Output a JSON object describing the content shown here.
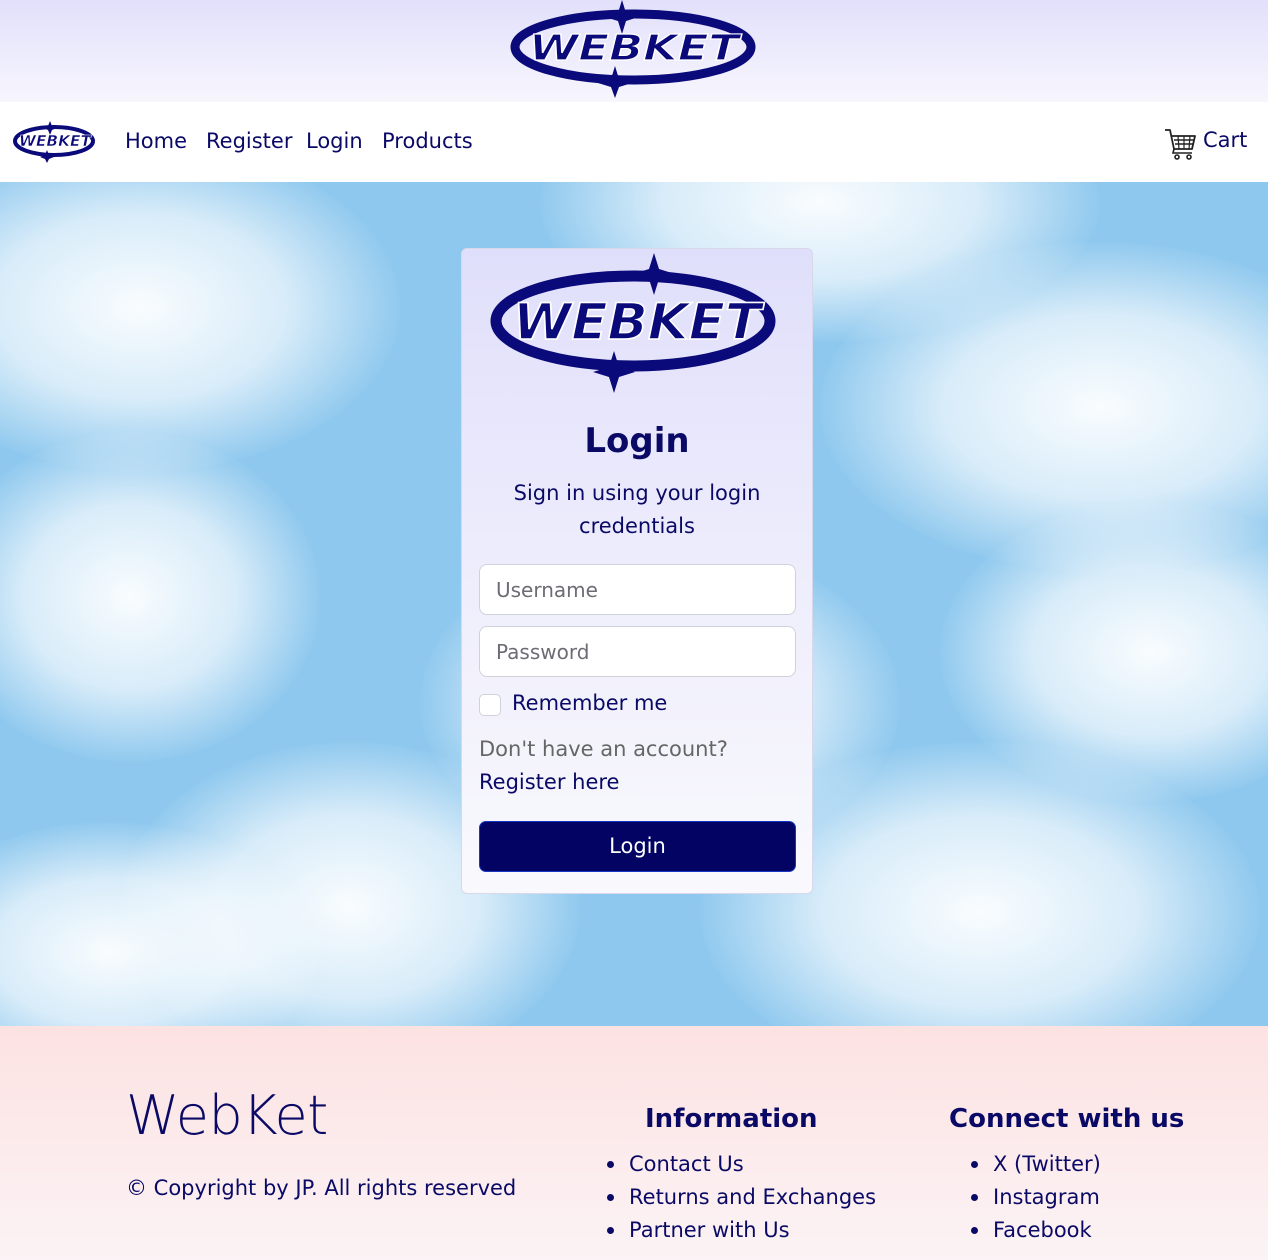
{
  "top_banner": {
    "logo_text": "WEBKET"
  },
  "navbar": {
    "logo_text": "WEBKET",
    "links": [
      "Home",
      "Register",
      "Login",
      "Products"
    ],
    "cart_label": "Cart",
    "cart_icon": "cart-icon"
  },
  "login_card": {
    "logo_text": "WEBKET",
    "title": "Login",
    "subtitle": "Sign in using your login credentials",
    "username_placeholder": "Username",
    "password_placeholder": "Password",
    "remember_label": "Remember me",
    "no_account_text": "Don't have an account? ",
    "register_link": "Register here",
    "login_button": "Login"
  },
  "footer": {
    "brand": "WebKet",
    "copyright": "© Copyright by JP. All rights reserved",
    "information": {
      "title": "Information",
      "items": [
        "Contact Us",
        "Returns and Exchanges",
        "Partner with Us"
      ]
    },
    "connect": {
      "title": "Connect with us",
      "items": [
        "X (Twitter)",
        "Instagram",
        "Facebook"
      ]
    }
  },
  "colors": {
    "brand_navy": "#0a0a66",
    "button_bg": "#030364",
    "sky_blue": "#8ec8ee",
    "footer_pink": "#fde2e2"
  }
}
